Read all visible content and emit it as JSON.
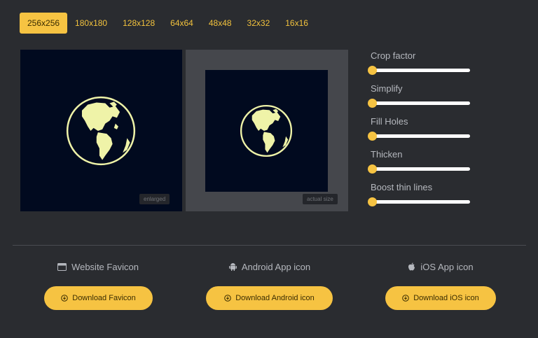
{
  "size_tabs": [
    {
      "label": "256x256",
      "active": true
    },
    {
      "label": "180x180",
      "active": false
    },
    {
      "label": "128x128",
      "active": false
    },
    {
      "label": "64x64",
      "active": false
    },
    {
      "label": "48x48",
      "active": false
    },
    {
      "label": "32x32",
      "active": false
    },
    {
      "label": "16x16",
      "active": false
    }
  ],
  "preview": {
    "enlarged_tag": "enlarged",
    "actual_tag": "actual size",
    "icon": "globe-americas-icon",
    "bg_color": "#010a1f",
    "icon_color": "#eff3a8"
  },
  "controls": [
    {
      "label": "Crop factor",
      "value": 0.0
    },
    {
      "label": "Simplify",
      "value": 0.0
    },
    {
      "label": "Fill Holes",
      "value": 0.0
    },
    {
      "label": "Thicken",
      "value": 0.0
    },
    {
      "label": "Boost thin lines",
      "value": 0.0
    }
  ],
  "downloads": {
    "favicon": {
      "title": "Website Favicon",
      "button": "Download Favicon",
      "icon": "browser-window-icon"
    },
    "android": {
      "title": "Android App icon",
      "button": "Download Android icon",
      "icon": "android-icon"
    },
    "ios": {
      "title": "iOS App icon",
      "button": "Download iOS icon",
      "icon": "apple-icon"
    }
  },
  "colors": {
    "accent": "#f6c342",
    "background": "#2a2c30",
    "tab_text": "#f2c23d"
  }
}
